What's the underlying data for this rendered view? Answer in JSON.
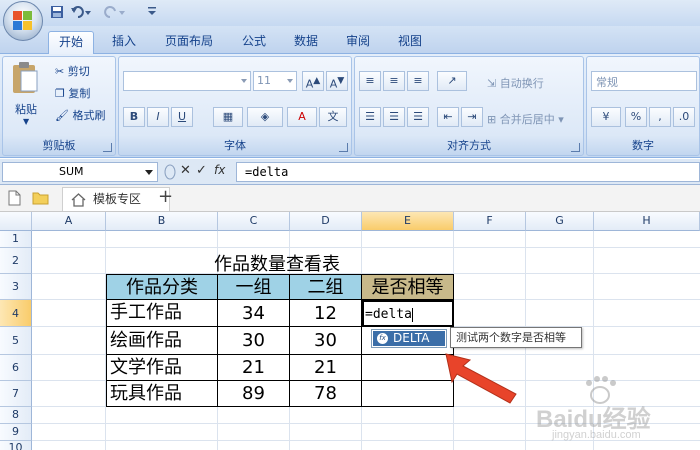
{
  "tabs": [
    "开始",
    "插入",
    "页面布局",
    "公式",
    "数据",
    "审阅",
    "视图"
  ],
  "ribbon": {
    "clipboard": {
      "label": "剪贴板",
      "paste": "粘贴",
      "cut": "剪切",
      "copy": "复制",
      "format_painter": "格式刷"
    },
    "font": {
      "label": "字体",
      "size": "11",
      "bold": "B",
      "italic": "I",
      "underline": "U"
    },
    "alignment": {
      "label": "对齐方式",
      "wrap": "自动换行",
      "merge": "合并后居中"
    },
    "number": {
      "label": "数字",
      "format": "常规",
      "percent": "%",
      "comma": ","
    }
  },
  "formula_bar": {
    "name": "SUM",
    "fx": "fx",
    "formula": "=delta"
  },
  "doc_tab": {
    "label": "模板专区",
    "add": "+"
  },
  "grid": {
    "columns": [
      "A",
      "B",
      "C",
      "D",
      "E",
      "F",
      "G",
      "H"
    ],
    "rows": [
      "1",
      "2",
      "3",
      "4",
      "5",
      "6",
      "7",
      "8",
      "9",
      "10"
    ],
    "selected_column": "E",
    "selected_row": "4"
  },
  "sheet": {
    "title": "作品数量查看表",
    "headers": [
      "作品分类",
      "一组",
      "二组",
      "是否相等"
    ],
    "rows": [
      {
        "category": "手工作品",
        "g1": "34",
        "g2": "12"
      },
      {
        "category": "绘画作品",
        "g1": "30",
        "g2": "30"
      },
      {
        "category": "文学作品",
        "g1": "21",
        "g2": "21"
      },
      {
        "category": "玩具作品",
        "g1": "89",
        "g2": "78"
      }
    ],
    "editing_value": "=delta"
  },
  "autocomplete": {
    "item": "DELTA",
    "tooltip": "测试两个数字是否相等"
  },
  "watermark": {
    "text": "Baidu经验",
    "sub": "jingyan.baidu.com"
  },
  "colors": {
    "header_fill": "#9fd2e6",
    "gold_header": "#c8b98a",
    "arrow": "#e8442a",
    "selected_header": "#f9cc6b"
  }
}
